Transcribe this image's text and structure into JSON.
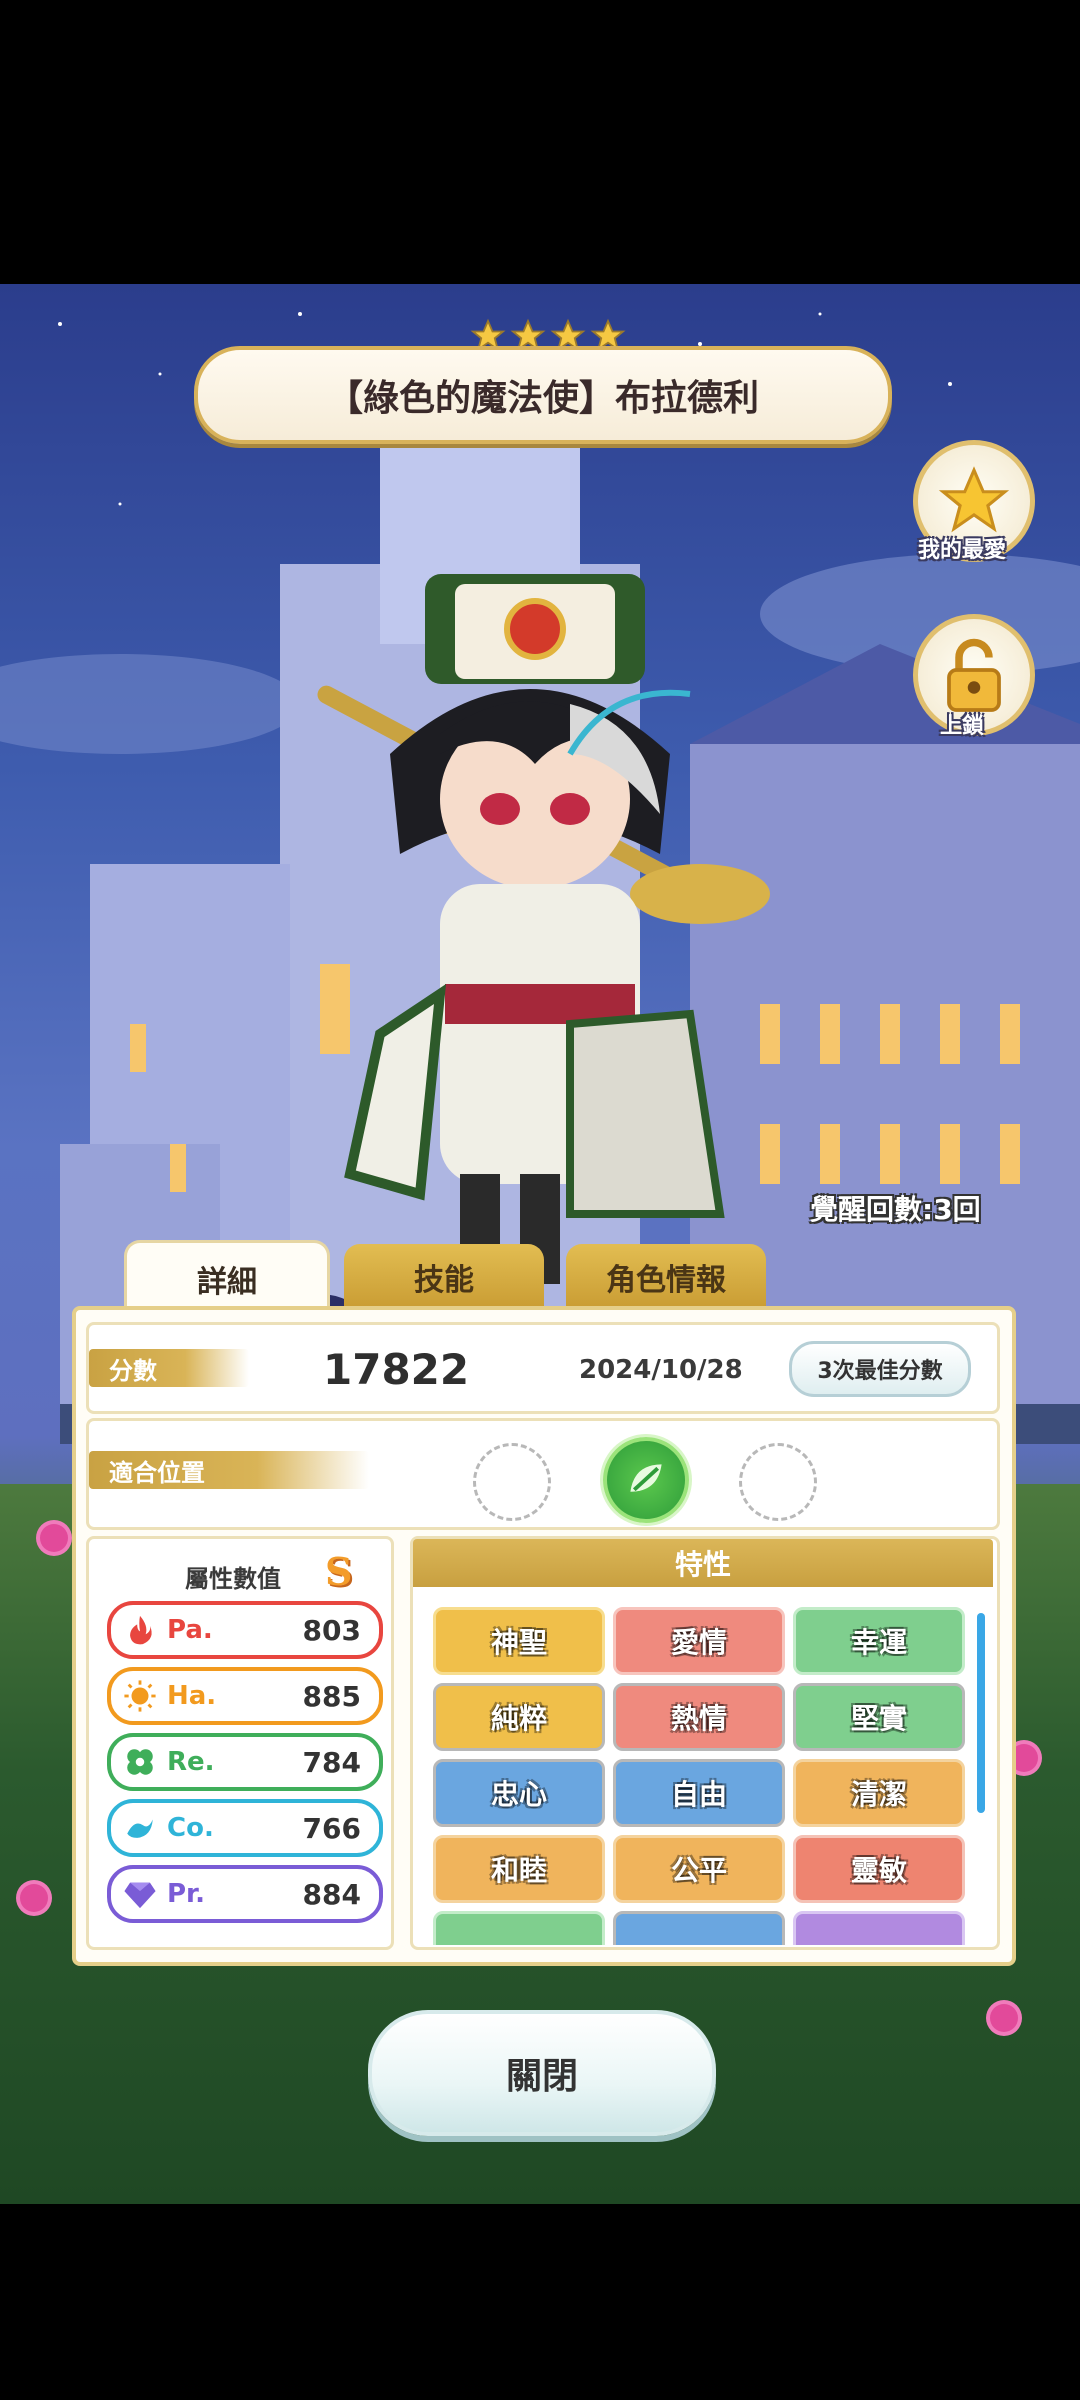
{
  "card": {
    "title": "【綠色的魔法使】布拉德利",
    "rarity_stars": 4,
    "awaken_text": "覺醒回數:3回"
  },
  "side_buttons": {
    "favorite_label": "我的最愛",
    "lock_label": "上鎖"
  },
  "tabs": [
    {
      "label": "詳細",
      "active": true
    },
    {
      "label": "技能",
      "active": false
    },
    {
      "label": "角色情報",
      "active": false
    }
  ],
  "score_row": {
    "label": "分數",
    "score": "17822",
    "date": "2024/10/28",
    "best_button": "3次最佳分數"
  },
  "position_row": {
    "label": "適合位置",
    "slots": [
      "empty",
      "filled",
      "empty"
    ]
  },
  "attributes": {
    "title": "屬性數值",
    "rank": "S",
    "items": [
      {
        "name": "Pa.",
        "value": "803",
        "color": "#e8463f",
        "icon": "fire-icon"
      },
      {
        "name": "Ha.",
        "value": "885",
        "color": "#f29a1e",
        "icon": "sun-icon"
      },
      {
        "name": "Re.",
        "value": "784",
        "color": "#3fae5a",
        "icon": "clover-icon"
      },
      {
        "name": "Co.",
        "value": "766",
        "color": "#2fb4d8",
        "icon": "wave-icon"
      },
      {
        "name": "Pr.",
        "value": "884",
        "color": "#7a5cd6",
        "icon": "gem-icon"
      }
    ]
  },
  "traits": {
    "title": "特性",
    "items": [
      {
        "label": "神聖",
        "color": "#f0bf4a"
      },
      {
        "label": "愛情",
        "color": "#ef8a7e"
      },
      {
        "label": "幸運",
        "color": "#7fcf8e"
      },
      {
        "label": "純粹",
        "color": "#f0bf4a"
      },
      {
        "label": "熱情",
        "color": "#ef8a7e"
      },
      {
        "label": "堅實",
        "color": "#7fcf8e"
      },
      {
        "label": "忠心",
        "color": "#6aa6e0"
      },
      {
        "label": "自由",
        "color": "#6aa6e0"
      },
      {
        "label": "清潔",
        "color": "#f0b45c"
      },
      {
        "label": "和睦",
        "color": "#f0b45c"
      },
      {
        "label": "公平",
        "color": "#f0b45c"
      },
      {
        "label": "靈敏",
        "color": "#ee8470"
      },
      {
        "label": "",
        "color": "#7fcf8e"
      },
      {
        "label": "",
        "color": "#6aa6e0"
      },
      {
        "label": "",
        "color": "#b18ae0"
      }
    ]
  },
  "close_button": "關閉"
}
